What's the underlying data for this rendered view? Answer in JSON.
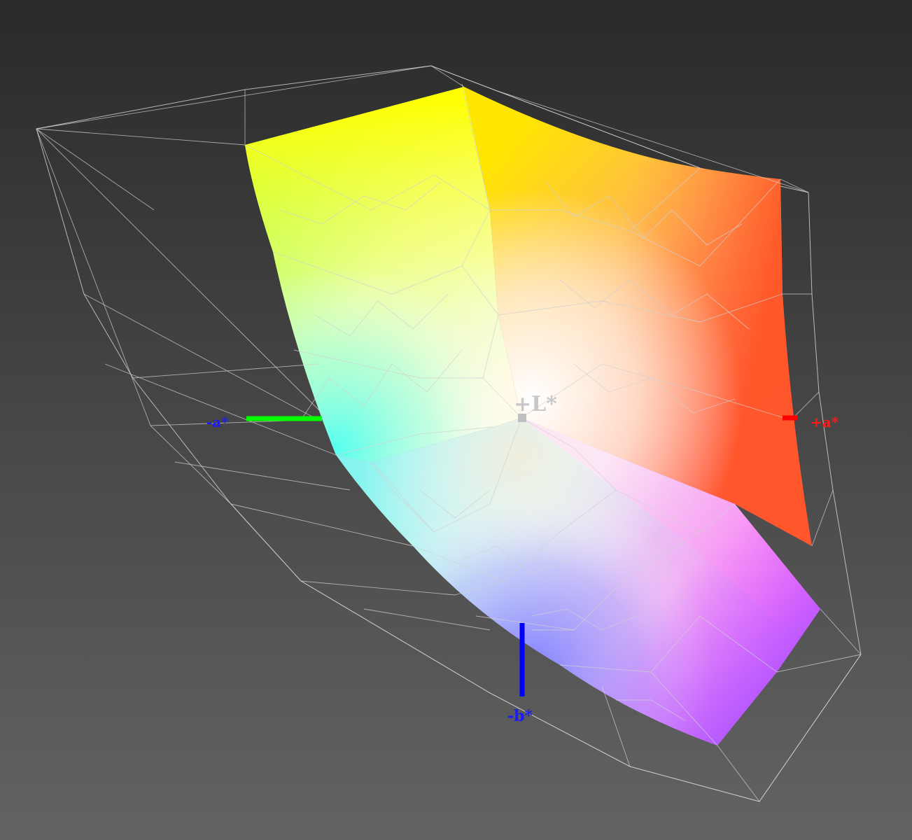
{
  "axis_labels": {
    "l_plus": "+L*",
    "a_minus": "-a*",
    "a_plus": "+a*",
    "b_minus": "-b*"
  },
  "colors": {
    "background_top": "#2a2a2a",
    "background_bottom": "#626262",
    "wireframe": "#d8d8d8",
    "l_axis": "#c0c0c0",
    "a_minus_axis": "#00ff00",
    "a_plus_axis": "#ff0000",
    "b_minus_axis": "#0000ff",
    "label_a_minus": "#1a1aff",
    "label_a_plus": "#ff1a1a",
    "label_b_minus": "#1a1aff",
    "label_l_plus": "#c8c8c8"
  }
}
